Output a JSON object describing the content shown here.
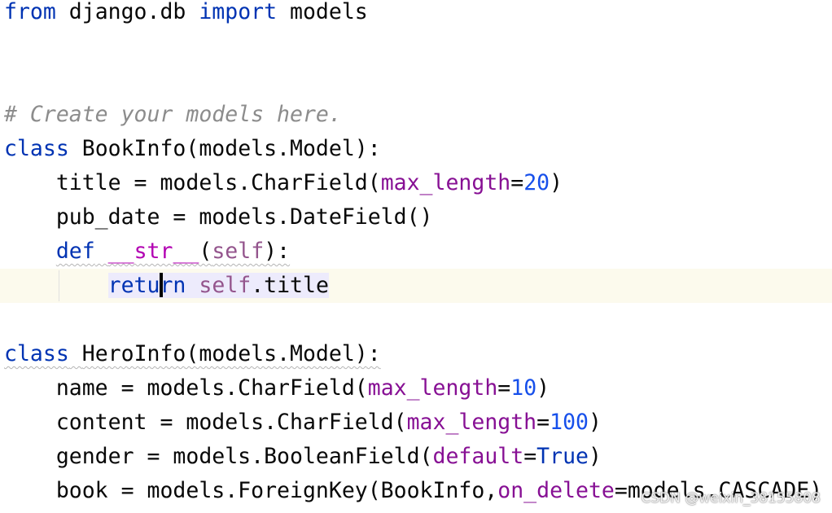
{
  "editor": {
    "language": "python",
    "colors": {
      "keyword": "#0033b3",
      "comment": "#8c8c8c",
      "keyword_argument": "#871094",
      "number": "#1750eb",
      "self": "#94558d",
      "dunder": "#b200b2",
      "current_line": "#fcfaed"
    },
    "lines": {
      "l1": {
        "kw_from": "from",
        "module": " django.db ",
        "kw_import": "import",
        "name": " models"
      },
      "l4": {
        "comment": "# Create your models here."
      },
      "l5": {
        "kw_class": "class",
        "rest": " BookInfo(models.Model):"
      },
      "l6": {
        "lhs": "    title = models.CharField(",
        "kwarg": "max_length",
        "eq": "=",
        "num": "20",
        "close": ")"
      },
      "l7": {
        "text": "    pub_date = models.DateField()"
      },
      "l8": {
        "indent": "    ",
        "kw_def": "def",
        "space": " ",
        "dunder": "__str__",
        "open": "(",
        "self": "self",
        "close": "):"
      },
      "l9": {
        "indent": "        ",
        "kw_ret_a": "retu",
        "kw_ret_b": "rn",
        "space": " ",
        "self": "self",
        "attr": ".title"
      },
      "l11": {
        "kw_class": "class",
        "space": " ",
        "rest": "HeroInfo(models.Model):"
      },
      "l12": {
        "lhs": "    name = models.CharField(",
        "kwarg": "max_length",
        "eq": "=",
        "num": "10",
        "close": ")"
      },
      "l13": {
        "lhs": "    content = models.CharField(",
        "kwarg": "max_length",
        "eq": "=",
        "num": "100",
        "close": ")"
      },
      "l14": {
        "lhs": "    gender = models.BooleanField(",
        "kwarg": "default",
        "eq": "=",
        "kw_true": "True",
        "close": ")"
      },
      "l15": {
        "lhs": "    book = models.ForeignKey(BookInfo,",
        "kwarg": "on_delete",
        "rest": "=models.CASCADE)"
      }
    }
  },
  "watermark": "CSDN @weixin_38155808"
}
